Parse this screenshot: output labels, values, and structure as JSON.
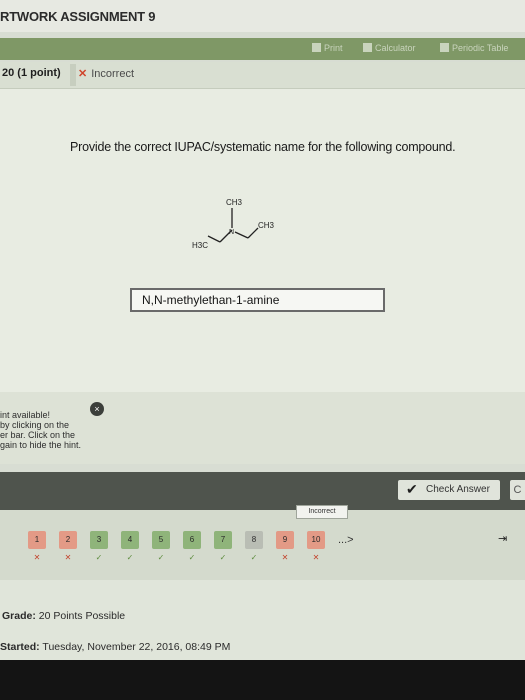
{
  "header": {
    "assignment_title": "RTWORK ASSIGNMENT 9"
  },
  "toolbar": {
    "print_label": "Print",
    "calculator_label": "Calculator",
    "periodic_label": "Periodic Table"
  },
  "question": {
    "number_label": "20 (1 point)",
    "status_label": "Incorrect",
    "status_mark": "✕",
    "prompt": "Provide the correct IUPAC/systematic name for the following compound.",
    "answer_value": "N,N-methylethan-1-amine"
  },
  "molecule": {
    "top_label": "CH3",
    "right_label": "CH3",
    "left_label": "H3C",
    "n_label": "N"
  },
  "hint": {
    "lines": [
      "int available!",
      "by clicking on the",
      "er bar. Click on the",
      "gain to hide the hint."
    ],
    "close_glyph": "×"
  },
  "actions": {
    "check_answer_label": "Check Answer",
    "check_icon": "check-icon",
    "next_glyph": "C"
  },
  "navigation": {
    "status_popup": "Incorrect",
    "pages": [
      {
        "label": "1",
        "state": "bad",
        "mark": "✕"
      },
      {
        "label": "2",
        "state": "bad",
        "mark": "✕"
      },
      {
        "label": "3",
        "state": "good",
        "mark": "✓"
      },
      {
        "label": "4",
        "state": "good",
        "mark": "✓"
      },
      {
        "label": "5",
        "state": "good",
        "mark": "✓"
      },
      {
        "label": "6",
        "state": "good",
        "mark": "✓"
      },
      {
        "label": "7",
        "state": "good",
        "mark": "✓"
      },
      {
        "label": "8",
        "state": "cur",
        "mark": "✓"
      },
      {
        "label": "9",
        "state": "bad",
        "mark": "✕"
      },
      {
        "label": "10",
        "state": "bad",
        "mark": "✕"
      }
    ],
    "more_label": "...>",
    "exit_glyph": "⇥"
  },
  "footer": {
    "grade_label": "Grade:",
    "grade_value": "20 Points Possible",
    "started_label": "Started:",
    "started_value": "Tuesday, November 22, 2016, 08:49 PM"
  }
}
